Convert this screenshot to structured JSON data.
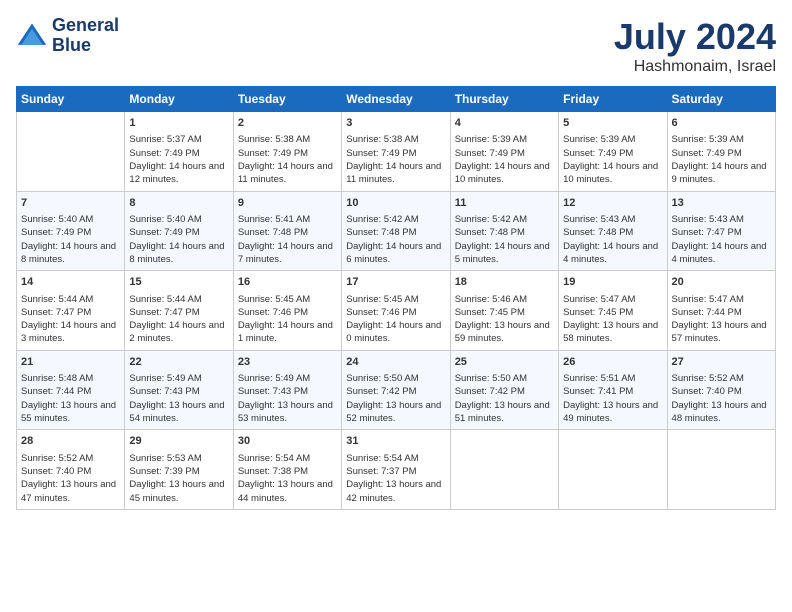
{
  "header": {
    "logo_line1": "General",
    "logo_line2": "Blue",
    "month": "July 2024",
    "location": "Hashmonaim, Israel"
  },
  "days_of_week": [
    "Sunday",
    "Monday",
    "Tuesday",
    "Wednesday",
    "Thursday",
    "Friday",
    "Saturday"
  ],
  "weeks": [
    [
      {
        "day": "",
        "empty": true
      },
      {
        "day": "1",
        "sunrise": "Sunrise: 5:37 AM",
        "sunset": "Sunset: 7:49 PM",
        "daylight": "Daylight: 14 hours and 12 minutes."
      },
      {
        "day": "2",
        "sunrise": "Sunrise: 5:38 AM",
        "sunset": "Sunset: 7:49 PM",
        "daylight": "Daylight: 14 hours and 11 minutes."
      },
      {
        "day": "3",
        "sunrise": "Sunrise: 5:38 AM",
        "sunset": "Sunset: 7:49 PM",
        "daylight": "Daylight: 14 hours and 11 minutes."
      },
      {
        "day": "4",
        "sunrise": "Sunrise: 5:39 AM",
        "sunset": "Sunset: 7:49 PM",
        "daylight": "Daylight: 14 hours and 10 minutes."
      },
      {
        "day": "5",
        "sunrise": "Sunrise: 5:39 AM",
        "sunset": "Sunset: 7:49 PM",
        "daylight": "Daylight: 14 hours and 10 minutes."
      },
      {
        "day": "6",
        "sunrise": "Sunrise: 5:39 AM",
        "sunset": "Sunset: 7:49 PM",
        "daylight": "Daylight: 14 hours and 9 minutes."
      }
    ],
    [
      {
        "day": "7",
        "sunrise": "Sunrise: 5:40 AM",
        "sunset": "Sunset: 7:49 PM",
        "daylight": "Daylight: 14 hours and 8 minutes."
      },
      {
        "day": "8",
        "sunrise": "Sunrise: 5:40 AM",
        "sunset": "Sunset: 7:49 PM",
        "daylight": "Daylight: 14 hours and 8 minutes."
      },
      {
        "day": "9",
        "sunrise": "Sunrise: 5:41 AM",
        "sunset": "Sunset: 7:48 PM",
        "daylight": "Daylight: 14 hours and 7 minutes."
      },
      {
        "day": "10",
        "sunrise": "Sunrise: 5:42 AM",
        "sunset": "Sunset: 7:48 PM",
        "daylight": "Daylight: 14 hours and 6 minutes."
      },
      {
        "day": "11",
        "sunrise": "Sunrise: 5:42 AM",
        "sunset": "Sunset: 7:48 PM",
        "daylight": "Daylight: 14 hours and 5 minutes."
      },
      {
        "day": "12",
        "sunrise": "Sunrise: 5:43 AM",
        "sunset": "Sunset: 7:48 PM",
        "daylight": "Daylight: 14 hours and 4 minutes."
      },
      {
        "day": "13",
        "sunrise": "Sunrise: 5:43 AM",
        "sunset": "Sunset: 7:47 PM",
        "daylight": "Daylight: 14 hours and 4 minutes."
      }
    ],
    [
      {
        "day": "14",
        "sunrise": "Sunrise: 5:44 AM",
        "sunset": "Sunset: 7:47 PM",
        "daylight": "Daylight: 14 hours and 3 minutes."
      },
      {
        "day": "15",
        "sunrise": "Sunrise: 5:44 AM",
        "sunset": "Sunset: 7:47 PM",
        "daylight": "Daylight: 14 hours and 2 minutes."
      },
      {
        "day": "16",
        "sunrise": "Sunrise: 5:45 AM",
        "sunset": "Sunset: 7:46 PM",
        "daylight": "Daylight: 14 hours and 1 minute."
      },
      {
        "day": "17",
        "sunrise": "Sunrise: 5:45 AM",
        "sunset": "Sunset: 7:46 PM",
        "daylight": "Daylight: 14 hours and 0 minutes."
      },
      {
        "day": "18",
        "sunrise": "Sunrise: 5:46 AM",
        "sunset": "Sunset: 7:45 PM",
        "daylight": "Daylight: 13 hours and 59 minutes."
      },
      {
        "day": "19",
        "sunrise": "Sunrise: 5:47 AM",
        "sunset": "Sunset: 7:45 PM",
        "daylight": "Daylight: 13 hours and 58 minutes."
      },
      {
        "day": "20",
        "sunrise": "Sunrise: 5:47 AM",
        "sunset": "Sunset: 7:44 PM",
        "daylight": "Daylight: 13 hours and 57 minutes."
      }
    ],
    [
      {
        "day": "21",
        "sunrise": "Sunrise: 5:48 AM",
        "sunset": "Sunset: 7:44 PM",
        "daylight": "Daylight: 13 hours and 55 minutes."
      },
      {
        "day": "22",
        "sunrise": "Sunrise: 5:49 AM",
        "sunset": "Sunset: 7:43 PM",
        "daylight": "Daylight: 13 hours and 54 minutes."
      },
      {
        "day": "23",
        "sunrise": "Sunrise: 5:49 AM",
        "sunset": "Sunset: 7:43 PM",
        "daylight": "Daylight: 13 hours and 53 minutes."
      },
      {
        "day": "24",
        "sunrise": "Sunrise: 5:50 AM",
        "sunset": "Sunset: 7:42 PM",
        "daylight": "Daylight: 13 hours and 52 minutes."
      },
      {
        "day": "25",
        "sunrise": "Sunrise: 5:50 AM",
        "sunset": "Sunset: 7:42 PM",
        "daylight": "Daylight: 13 hours and 51 minutes."
      },
      {
        "day": "26",
        "sunrise": "Sunrise: 5:51 AM",
        "sunset": "Sunset: 7:41 PM",
        "daylight": "Daylight: 13 hours and 49 minutes."
      },
      {
        "day": "27",
        "sunrise": "Sunrise: 5:52 AM",
        "sunset": "Sunset: 7:40 PM",
        "daylight": "Daylight: 13 hours and 48 minutes."
      }
    ],
    [
      {
        "day": "28",
        "sunrise": "Sunrise: 5:52 AM",
        "sunset": "Sunset: 7:40 PM",
        "daylight": "Daylight: 13 hours and 47 minutes."
      },
      {
        "day": "29",
        "sunrise": "Sunrise: 5:53 AM",
        "sunset": "Sunset: 7:39 PM",
        "daylight": "Daylight: 13 hours and 45 minutes."
      },
      {
        "day": "30",
        "sunrise": "Sunrise: 5:54 AM",
        "sunset": "Sunset: 7:38 PM",
        "daylight": "Daylight: 13 hours and 44 minutes."
      },
      {
        "day": "31",
        "sunrise": "Sunrise: 5:54 AM",
        "sunset": "Sunset: 7:37 PM",
        "daylight": "Daylight: 13 hours and 42 minutes."
      },
      {
        "day": "",
        "empty": true
      },
      {
        "day": "",
        "empty": true
      },
      {
        "day": "",
        "empty": true
      }
    ]
  ]
}
